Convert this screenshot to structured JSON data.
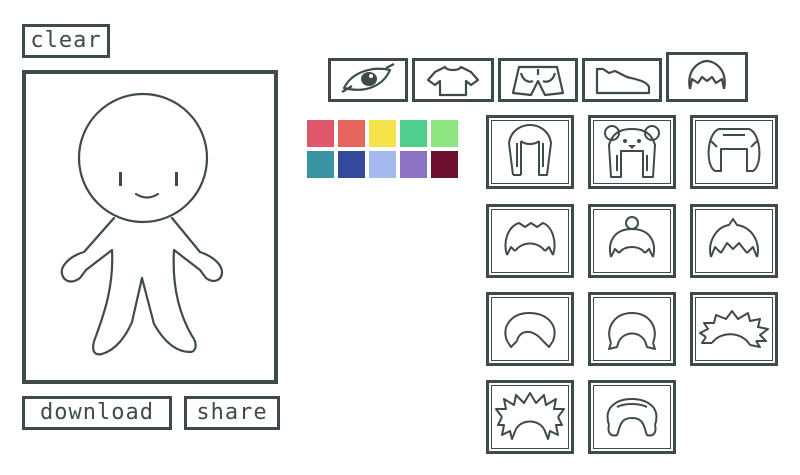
{
  "buttons": {
    "clear": "clear",
    "download": "download",
    "share": "share"
  },
  "tabs": [
    {
      "name": "eyes",
      "icon": "eye-icon",
      "active": false
    },
    {
      "name": "tops",
      "icon": "shirt-icon",
      "active": false
    },
    {
      "name": "bottoms",
      "icon": "shorts-icon",
      "active": false
    },
    {
      "name": "shoes",
      "icon": "shoe-icon",
      "active": false
    },
    {
      "name": "hair",
      "icon": "hair-icon",
      "active": true
    }
  ],
  "colors": {
    "ink": "#3f4a4c",
    "swatches": [
      "#e0566a",
      "#e5645e",
      "#f5e34a",
      "#4fcf8c",
      "#8fe67e",
      "#3a93a0",
      "#35499c",
      "#a6b9ef",
      "#8c73c5",
      "#6e0f30"
    ]
  },
  "hair_items": [
    "hair-straight-icon",
    "hair-bear-hood-icon",
    "hair-bob-icon",
    "hair-short-spiky-icon",
    "hair-bun-icon",
    "hair-tufted-icon",
    "hair-side-part-icon",
    "hair-bowl-icon",
    "hair-messy-icon",
    "hair-wild-spiky-icon",
    "hair-fluffy-icon"
  ]
}
